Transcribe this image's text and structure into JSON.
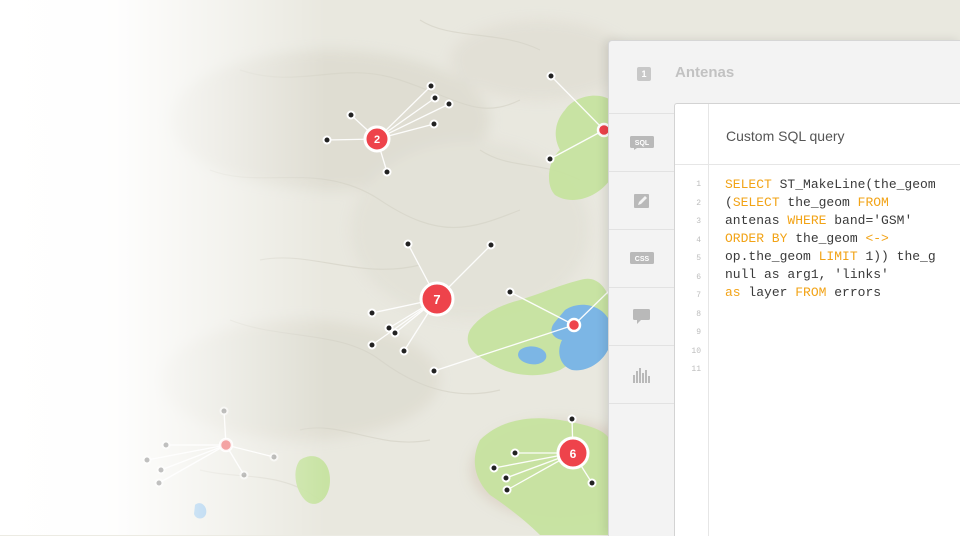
{
  "map": {
    "clusters": [
      {
        "count": "2"
      },
      {
        "count": "7"
      },
      {
        "count": "6"
      }
    ]
  },
  "panel": {
    "layer_number": "1",
    "layer_title": "Antenas",
    "side_icons": [
      {
        "name": "sql-icon",
        "label": "SQL"
      },
      {
        "name": "wizard-icon",
        "label": ""
      },
      {
        "name": "css-icon",
        "label": "CSS"
      },
      {
        "name": "infowindow-icon",
        "label": ""
      },
      {
        "name": "legends-icon",
        "label": ""
      }
    ]
  },
  "editor": {
    "title": "Custom SQL query",
    "line_numbers": [
      "1",
      "2",
      "3",
      "4",
      "5",
      "6",
      "7",
      "8",
      "9",
      "10",
      "11"
    ],
    "code_lines": [
      [
        {
          "t": "SELECT",
          "kw": true
        },
        {
          "t": " ST_MakeLine(the_geom"
        }
      ],
      [
        {
          "t": "("
        },
        {
          "t": "SELECT",
          "kw": true
        },
        {
          "t": " the_geom "
        },
        {
          "t": "FROM",
          "kw": true
        }
      ],
      [
        {
          "t": "antenas "
        },
        {
          "t": "WHERE",
          "kw": true
        },
        {
          "t": " band='GSM'"
        }
      ],
      [
        {
          "t": "ORDER BY",
          "kw": true
        },
        {
          "t": " the_geom "
        },
        {
          "t": "<->",
          "kw": true
        }
      ],
      [
        {
          "t": "op.the_geom "
        },
        {
          "t": "LIMIT",
          "kw": true
        },
        {
          "t": " 1)) the_g"
        }
      ],
      [
        {
          "t": "null as arg1, 'links'"
        }
      ],
      [
        {
          "t": "as",
          "kw": true
        },
        {
          "t": " layer "
        },
        {
          "t": "FROM",
          "kw": true
        },
        {
          "t": " errors"
        }
      ]
    ]
  },
  "colors": {
    "cluster_red": "#ee434b",
    "keyword": "#f2a316",
    "park_green": "#c3e29b",
    "water_blue": "#79b4e4"
  }
}
